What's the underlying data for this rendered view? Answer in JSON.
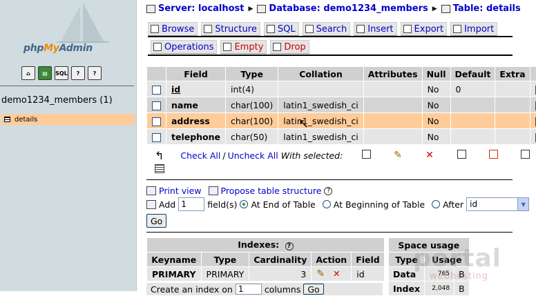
{
  "nav": {
    "logo_pre": "php",
    "logo_my": "My",
    "logo_post": "Admin",
    "icons": [
      "home-icon",
      "query-icon",
      "sql-icon",
      "docs-icon",
      "doc2-icon"
    ],
    "icon_labels": [
      "⌂",
      "▤",
      "SQL",
      "?",
      "?"
    ],
    "database": "demo1234_members (1)",
    "table": "details"
  },
  "breadcrumb": {
    "server": "Server: localhost",
    "database": "Database: demo1234_members",
    "table": "Table: details"
  },
  "tabs_row1": [
    "Browse",
    "Structure",
    "SQL",
    "Search",
    "Insert",
    "Export",
    "Import"
  ],
  "tabs_row2": [
    "Operations",
    "Empty",
    "Drop"
  ],
  "structure": {
    "headers": [
      "Field",
      "Type",
      "Collation",
      "Attributes",
      "Null",
      "Default",
      "Extra"
    ],
    "rows": [
      {
        "field": "id",
        "type": "int(4)",
        "collation": "",
        "attributes": "",
        "null": "No",
        "default": "0",
        "extra": ""
      },
      {
        "field": "name",
        "type": "char(100)",
        "collation": "latin1_swedish_ci",
        "attributes": "",
        "null": "No",
        "default": "",
        "extra": ""
      },
      {
        "field": "address",
        "type": "char(100)",
        "collation": "latin1_swedish_ci",
        "attributes": "",
        "null": "No",
        "default": "",
        "extra": ""
      },
      {
        "field": "telephone",
        "type": "char(50)",
        "collation": "latin1_swedish_ci",
        "attributes": "",
        "null": "No",
        "default": "",
        "extra": ""
      }
    ]
  },
  "checkall": {
    "check_all": "Check All",
    "slash": "/",
    "uncheck_all": "Uncheck All",
    "with_selected": "With selected:"
  },
  "print_view": "Print view",
  "propose": "Propose table structure",
  "add_field": {
    "add": "Add",
    "count": "1",
    "fields_label": "field(s)",
    "at_end": "At End of Table",
    "at_beginning": "At Beginning of Table",
    "after": "After",
    "after_value": "id",
    "go": "Go"
  },
  "indexes": {
    "title": "Indexes:",
    "headers": [
      "Keyname",
      "Type",
      "Cardinality",
      "Action",
      "Field"
    ],
    "row": {
      "keyname": "PRIMARY",
      "type": "PRIMARY",
      "cardinality": "3",
      "field": "id"
    },
    "create_pre": "Create an index on",
    "create_count": "1",
    "create_post": "columns",
    "go": "Go"
  },
  "space": {
    "title": "Space usage",
    "headers": [
      "Type",
      "Usage"
    ],
    "rows": [
      {
        "type": "Data",
        "usage": "765",
        "unit": "B"
      },
      {
        "type": "Index",
        "usage": "2,048",
        "unit": "B"
      }
    ]
  },
  "watermark": {
    "main": "portal",
    "sub": "webhosting"
  }
}
